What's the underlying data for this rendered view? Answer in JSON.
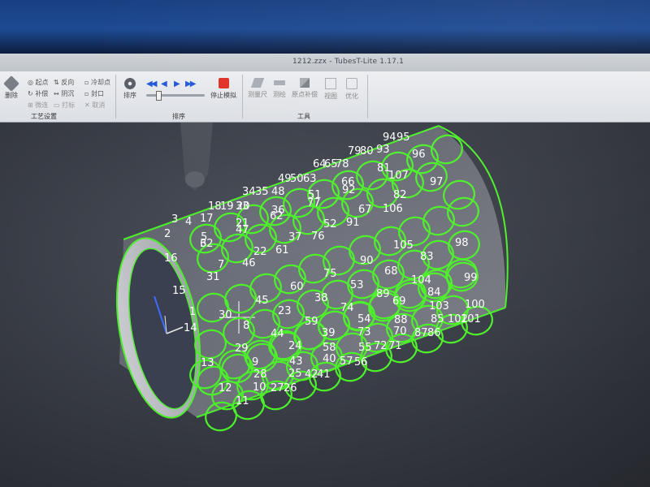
{
  "window": {
    "title": "1212.zzx - TubesT-Lite 1.17.1"
  },
  "ribbon": {
    "group_craft": {
      "label": "工艺设置",
      "big_button": "删除",
      "items": [
        "起点",
        "反向",
        "冷却点",
        "补偿",
        "阴沉",
        "封口",
        "微连",
        "打标",
        "取消"
      ]
    },
    "group_sort": {
      "label": "排序",
      "sort_button": "排序",
      "stop_button": "停止模拟"
    },
    "group_tools": {
      "label": "工具",
      "buttons": [
        "测量尺",
        "测绘",
        "原点补偿",
        "视图",
        "优化"
      ]
    }
  },
  "hole_labels": [
    {
      "t": "1"
    },
    {
      "t": "2"
    },
    {
      "t": "3"
    },
    {
      "t": "4"
    },
    {
      "t": "5"
    },
    {
      "t": "6"
    },
    {
      "t": "7"
    },
    {
      "t": "8"
    },
    {
      "t": "9"
    },
    {
      "t": "10"
    },
    {
      "t": "11"
    },
    {
      "t": "12"
    },
    {
      "t": "13"
    },
    {
      "t": "14"
    },
    {
      "t": "15"
    },
    {
      "t": "16"
    },
    {
      "t": "17"
    },
    {
      "t": "18"
    },
    {
      "t": "19"
    },
    {
      "t": "20"
    },
    {
      "t": "21"
    },
    {
      "t": "22"
    },
    {
      "t": "23"
    },
    {
      "t": "24"
    },
    {
      "t": "25"
    },
    {
      "t": "26"
    },
    {
      "t": "27"
    },
    {
      "t": "28"
    },
    {
      "t": "29"
    },
    {
      "t": "30"
    },
    {
      "t": "31"
    },
    {
      "t": "32"
    },
    {
      "t": "33"
    },
    {
      "t": "34"
    },
    {
      "t": "35"
    },
    {
      "t": "36"
    },
    {
      "t": "37"
    },
    {
      "t": "38"
    },
    {
      "t": "39"
    },
    {
      "t": "40"
    },
    {
      "t": "41"
    },
    {
      "t": "42"
    },
    {
      "t": "43"
    },
    {
      "t": "44"
    },
    {
      "t": "45"
    },
    {
      "t": "46"
    },
    {
      "t": "47"
    },
    {
      "t": "48"
    },
    {
      "t": "49"
    },
    {
      "t": "50"
    },
    {
      "t": "51"
    },
    {
      "t": "52"
    },
    {
      "t": "53"
    },
    {
      "t": "54"
    },
    {
      "t": "55"
    },
    {
      "t": "56"
    },
    {
      "t": "57"
    },
    {
      "t": "58"
    },
    {
      "t": "59"
    },
    {
      "t": "60"
    },
    {
      "t": "61"
    },
    {
      "t": "62"
    },
    {
      "t": "63"
    },
    {
      "t": "64"
    },
    {
      "t": "65"
    },
    {
      "t": "66"
    },
    {
      "t": "67"
    },
    {
      "t": "68"
    },
    {
      "t": "69"
    },
    {
      "t": "70"
    },
    {
      "t": "71"
    },
    {
      "t": "72"
    },
    {
      "t": "73"
    },
    {
      "t": "74"
    },
    {
      "t": "75"
    },
    {
      "t": "76"
    },
    {
      "t": "77"
    },
    {
      "t": "78"
    },
    {
      "t": "79"
    },
    {
      "t": "80"
    },
    {
      "t": "81"
    },
    {
      "t": "82"
    },
    {
      "t": "83"
    },
    {
      "t": "84"
    },
    {
      "t": "85"
    },
    {
      "t": "86"
    },
    {
      "t": "87"
    },
    {
      "t": "88"
    },
    {
      "t": "89"
    },
    {
      "t": "90"
    },
    {
      "t": "91"
    },
    {
      "t": "92"
    },
    {
      "t": "93"
    },
    {
      "t": "94"
    },
    {
      "t": "95"
    },
    {
      "t": "96"
    },
    {
      "t": "97"
    },
    {
      "t": "98"
    },
    {
      "t": "99"
    },
    {
      "t": "100"
    },
    {
      "t": "101"
    },
    {
      "t": "102"
    },
    {
      "t": "103"
    },
    {
      "t": "104"
    },
    {
      "t": "105"
    },
    {
      "t": "106"
    },
    {
      "t": "107"
    }
  ],
  "colors": {
    "outline": "#4cf02a",
    "label": "#ffffff",
    "tube_fill": "#8c8f98",
    "stop_red": "#e0312a",
    "play_blue": "#2458d8"
  }
}
